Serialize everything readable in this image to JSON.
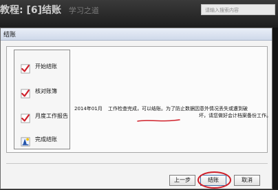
{
  "background": {
    "title_left": "教程: [6]结账",
    "subtitle": "学习之道",
    "search_placeholder": "请输入搜索内容"
  },
  "dialog": {
    "title": "结账",
    "steps": [
      {
        "label": "开始结账",
        "icon": "check-icon"
      },
      {
        "label": "核对账簿",
        "icon": "check-icon"
      },
      {
        "label": "月度工作报告",
        "icon": "check-icon"
      },
      {
        "label": "完成结账",
        "icon": "wizard-icon"
      }
    ],
    "message": {
      "period": "2014年01月",
      "line1_rest": "工作检查完成，可以结账。为了防止数据因意外情况丢失或遭到破",
      "line2": "坏，请您做好会计档案备份工作。"
    },
    "buttons": {
      "prev": "上一步",
      "finish": "结账",
      "cancel": "取消"
    }
  },
  "colors": {
    "accent_red": "#d0202a",
    "titlebar_top": "#e9eef7",
    "titlebar_bottom": "#cfd9ea",
    "wizard_blue": "#1d4fa8",
    "wizard_yellow": "#f2c200"
  }
}
